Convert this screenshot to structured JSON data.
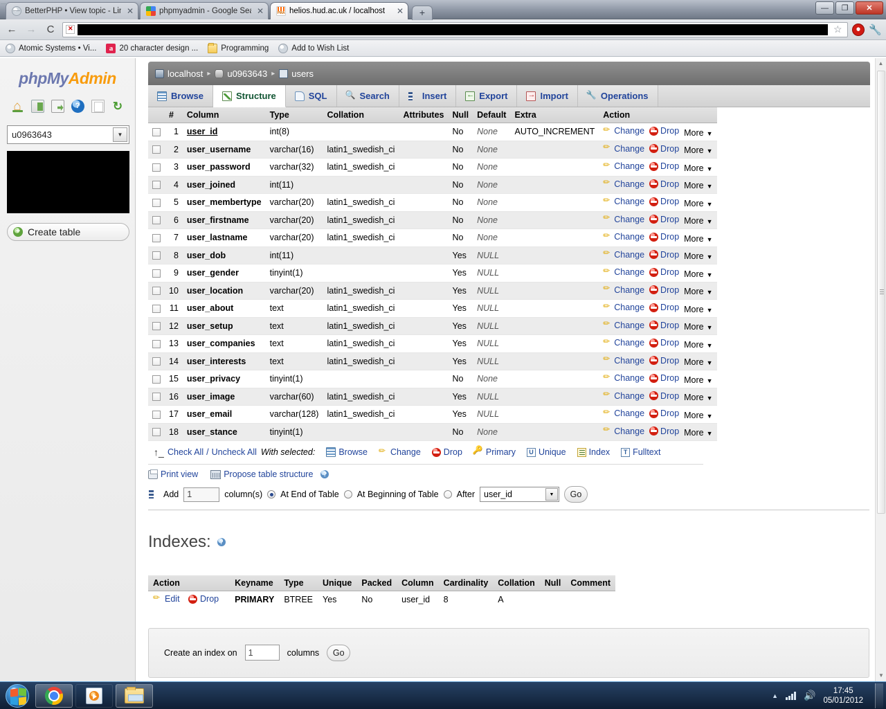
{
  "browser": {
    "tabs": [
      {
        "title": "BetterPHP • View topic - Lin",
        "favicon": "globe-favicon",
        "active": false,
        "close_label": "✕"
      },
      {
        "title": "phpmyadmin - Google Sea",
        "favicon": "google-favicon",
        "active": false,
        "close_label": "✕"
      },
      {
        "title": "helios.hud.ac.uk / localhost",
        "favicon": "phpmyadmin-favicon",
        "active": true,
        "close_label": "✕"
      }
    ],
    "new_tab_label": "+",
    "window_controls": {
      "minimize": "—",
      "maximize": "❐",
      "close": "✕"
    },
    "nav": {
      "back": "←",
      "forward": "→",
      "reload": "C"
    },
    "omnibox": {
      "value": "",
      "placeholder": ""
    },
    "star_label": "☆",
    "bookmarks": [
      {
        "label": "Atomic Systems • Vi...",
        "icon": "globe-icon"
      },
      {
        "label": "20 character design ...",
        "icon": "amazon-icon"
      },
      {
        "label": "Programming",
        "icon": "folder-icon"
      },
      {
        "label": "Add to Wish List",
        "icon": "globe-icon"
      }
    ]
  },
  "sidebar": {
    "logo": {
      "php": "php",
      "my": "My",
      "admin": "Admin"
    },
    "icons": [
      {
        "name": "home-icon",
        "title": "Home"
      },
      {
        "name": "logout-icon",
        "title": "Log out"
      },
      {
        "name": "query-window-icon",
        "title": "SQL query window"
      },
      {
        "name": "help-icon",
        "title": "phpMyAdmin documentation"
      },
      {
        "name": "documentation-icon",
        "title": "Documentation"
      },
      {
        "name": "reload-icon",
        "title": "Reload navigation frame"
      }
    ],
    "database_select": {
      "value": "u0963643",
      "arrow": "▼"
    },
    "create_table_label": "Create table"
  },
  "breadcrumb": {
    "server": "localhost",
    "database": "u0963643",
    "table": "users",
    "separator": "▸"
  },
  "tabs": [
    {
      "label": "Browse",
      "icon": "browse-icon",
      "active": false
    },
    {
      "label": "Structure",
      "icon": "structure-icon",
      "active": true
    },
    {
      "label": "SQL",
      "icon": "sql-icon",
      "active": false
    },
    {
      "label": "Search",
      "icon": "search-icon",
      "active": false
    },
    {
      "label": "Insert",
      "icon": "insert-icon",
      "active": false
    },
    {
      "label": "Export",
      "icon": "export-icon",
      "active": false
    },
    {
      "label": "Import",
      "icon": "import-icon",
      "active": false
    },
    {
      "label": "Operations",
      "icon": "operations-icon",
      "active": false
    }
  ],
  "structure": {
    "headers": {
      "num": "#",
      "column": "Column",
      "type": "Type",
      "collation": "Collation",
      "attributes": "Attributes",
      "null": "Null",
      "default": "Default",
      "extra": "Extra",
      "action": "Action"
    },
    "action_labels": {
      "change": "Change",
      "drop": "Drop",
      "more": "More",
      "caret": "▼"
    },
    "rows": [
      {
        "num": "1",
        "column": "user_id",
        "type": "int(8)",
        "collation": "",
        "attributes": "",
        "null": "No",
        "default": "None",
        "extra": "AUTO_INCREMENT",
        "primary": true
      },
      {
        "num": "2",
        "column": "user_username",
        "type": "varchar(16)",
        "collation": "latin1_swedish_ci",
        "attributes": "",
        "null": "No",
        "default": "None",
        "extra": "",
        "primary": false
      },
      {
        "num": "3",
        "column": "user_password",
        "type": "varchar(32)",
        "collation": "latin1_swedish_ci",
        "attributes": "",
        "null": "No",
        "default": "None",
        "extra": "",
        "primary": false
      },
      {
        "num": "4",
        "column": "user_joined",
        "type": "int(11)",
        "collation": "",
        "attributes": "",
        "null": "No",
        "default": "None",
        "extra": "",
        "primary": false
      },
      {
        "num": "5",
        "column": "user_membertype",
        "type": "varchar(20)",
        "collation": "latin1_swedish_ci",
        "attributes": "",
        "null": "No",
        "default": "None",
        "extra": "",
        "primary": false
      },
      {
        "num": "6",
        "column": "user_firstname",
        "type": "varchar(20)",
        "collation": "latin1_swedish_ci",
        "attributes": "",
        "null": "No",
        "default": "None",
        "extra": "",
        "primary": false
      },
      {
        "num": "7",
        "column": "user_lastname",
        "type": "varchar(20)",
        "collation": "latin1_swedish_ci",
        "attributes": "",
        "null": "No",
        "default": "None",
        "extra": "",
        "primary": false
      },
      {
        "num": "8",
        "column": "user_dob",
        "type": "int(11)",
        "collation": "",
        "attributes": "",
        "null": "Yes",
        "default": "NULL",
        "extra": "",
        "primary": false
      },
      {
        "num": "9",
        "column": "user_gender",
        "type": "tinyint(1)",
        "collation": "",
        "attributes": "",
        "null": "Yes",
        "default": "NULL",
        "extra": "",
        "primary": false
      },
      {
        "num": "10",
        "column": "user_location",
        "type": "varchar(20)",
        "collation": "latin1_swedish_ci",
        "attributes": "",
        "null": "Yes",
        "default": "NULL",
        "extra": "",
        "primary": false
      },
      {
        "num": "11",
        "column": "user_about",
        "type": "text",
        "collation": "latin1_swedish_ci",
        "attributes": "",
        "null": "Yes",
        "default": "NULL",
        "extra": "",
        "primary": false
      },
      {
        "num": "12",
        "column": "user_setup",
        "type": "text",
        "collation": "latin1_swedish_ci",
        "attributes": "",
        "null": "Yes",
        "default": "NULL",
        "extra": "",
        "primary": false
      },
      {
        "num": "13",
        "column": "user_companies",
        "type": "text",
        "collation": "latin1_swedish_ci",
        "attributes": "",
        "null": "Yes",
        "default": "NULL",
        "extra": "",
        "primary": false
      },
      {
        "num": "14",
        "column": "user_interests",
        "type": "text",
        "collation": "latin1_swedish_ci",
        "attributes": "",
        "null": "Yes",
        "default": "NULL",
        "extra": "",
        "primary": false
      },
      {
        "num": "15",
        "column": "user_privacy",
        "type": "tinyint(1)",
        "collation": "",
        "attributes": "",
        "null": "No",
        "default": "None",
        "extra": "",
        "primary": false
      },
      {
        "num": "16",
        "column": "user_image",
        "type": "varchar(60)",
        "collation": "latin1_swedish_ci",
        "attributes": "",
        "null": "Yes",
        "default": "NULL",
        "extra": "",
        "primary": false
      },
      {
        "num": "17",
        "column": "user_email",
        "type": "varchar(128)",
        "collation": "latin1_swedish_ci",
        "attributes": "",
        "null": "Yes",
        "default": "NULL",
        "extra": "",
        "primary": false
      },
      {
        "num": "18",
        "column": "user_stance",
        "type": "tinyint(1)",
        "collation": "",
        "attributes": "",
        "null": "No",
        "default": "None",
        "extra": "",
        "primary": false
      }
    ]
  },
  "with_selected": {
    "check_all": "Check All",
    "slash": "/",
    "uncheck_all": "Uncheck All",
    "label": "With selected:",
    "actions": [
      {
        "label": "Browse",
        "icon": "browse-icon"
      },
      {
        "label": "Change",
        "icon": "pencil-icon"
      },
      {
        "label": "Drop",
        "icon": "drop-icon"
      },
      {
        "label": "Primary",
        "icon": "key-icon"
      },
      {
        "label": "Unique",
        "icon": "unique-icon"
      },
      {
        "label": "Index",
        "icon": "index-icon"
      },
      {
        "label": "Fulltext",
        "icon": "fulltext-icon"
      }
    ]
  },
  "print_row": {
    "print_view": "Print view",
    "propose": "Propose table structure",
    "info_label": "?"
  },
  "add_row": {
    "add_label": "Add",
    "count_value": "1",
    "columns_label": "column(s)",
    "at_end": "At End of Table",
    "at_beginning": "At Beginning of Table",
    "after": "After",
    "after_select_value": "user_id",
    "select_arrow": "▼",
    "go_label": "Go",
    "selected_position": "at_end"
  },
  "indexes": {
    "title": "Indexes:",
    "info_label": "?",
    "headers": [
      "Action",
      "Keyname",
      "Type",
      "Unique",
      "Packed",
      "Column",
      "Cardinality",
      "Collation",
      "Null",
      "Comment"
    ],
    "action_labels": {
      "edit": "Edit",
      "drop": "Drop"
    },
    "rows": [
      {
        "keyname": "PRIMARY",
        "type": "BTREE",
        "unique": "Yes",
        "packed": "No",
        "column": "user_id",
        "cardinality": "8",
        "collation": "A",
        "null": "",
        "comment": ""
      }
    ],
    "create_index": {
      "label": "Create an index on",
      "value": "1",
      "columns_label": "columns",
      "go_label": "Go"
    }
  },
  "taskbar": {
    "start_label": "Start",
    "items": [
      {
        "name": "chrome",
        "label": "Google Chrome",
        "active": true
      },
      {
        "name": "media-player",
        "label": "Media Player",
        "active": false
      },
      {
        "name": "explorer",
        "label": "Windows Explorer",
        "active": true
      }
    ],
    "tray": {
      "caret": "▲",
      "volume": "🔊",
      "time": "17:45",
      "date": "05/01/2012"
    }
  }
}
